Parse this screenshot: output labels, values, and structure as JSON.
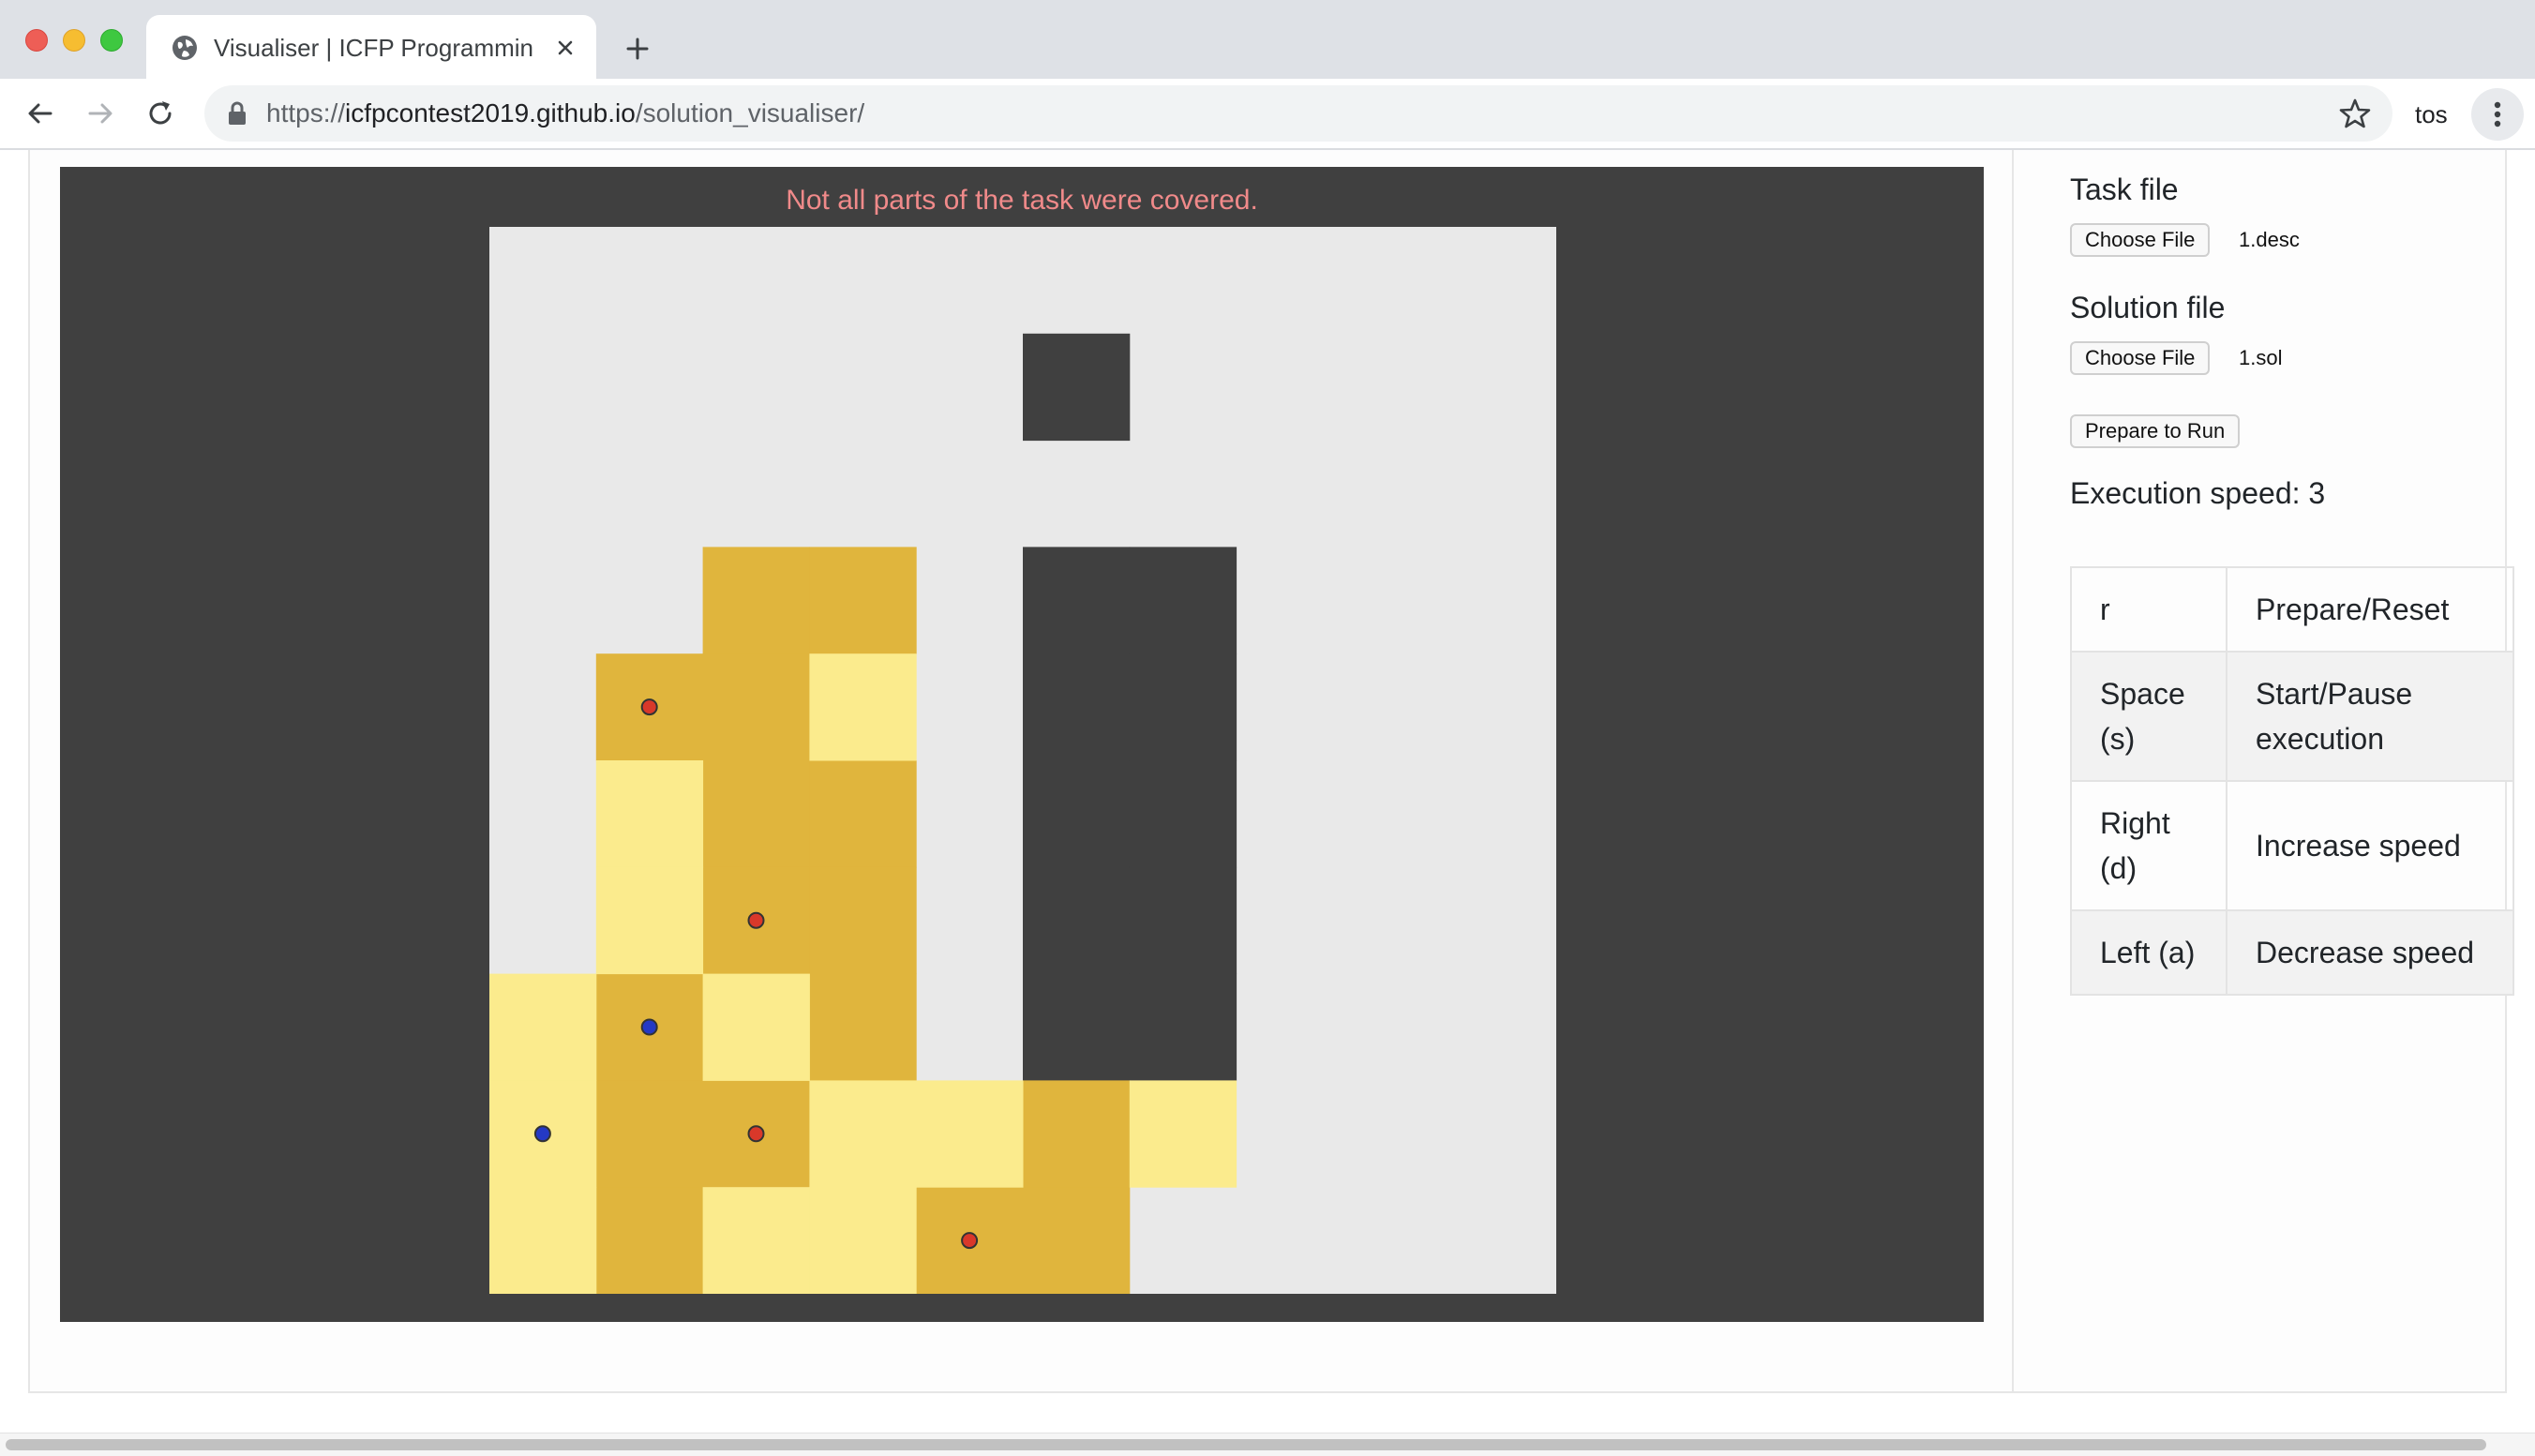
{
  "browser": {
    "tab_title": "Visualiser | ICFP Programming",
    "url_scheme": "https://",
    "url_host": "icfpcontest2019.github.io",
    "url_path": "/solution_visualiser/",
    "profile_name": "tos"
  },
  "canvas": {
    "status_message": "Not all parts of the task were covered.",
    "grid": {
      "cells": 10,
      "colors": {
        "free": "#e9e9e9",
        "obstacle": "#404040",
        "wrapped": "#e0b53d",
        "covered": "#fbeb8d",
        "booster_red": "#d9382a",
        "booster_blue": "#2439c5"
      },
      "obstacles": [
        [
          5,
          1
        ],
        [
          5,
          3
        ],
        [
          5,
          4
        ],
        [
          5,
          5
        ],
        [
          5,
          6
        ],
        [
          5,
          7
        ],
        [
          6,
          3
        ],
        [
          6,
          4
        ],
        [
          6,
          5
        ],
        [
          6,
          6
        ],
        [
          6,
          7
        ]
      ],
      "wrapped": [
        [
          2,
          3
        ],
        [
          3,
          3
        ],
        [
          1,
          4
        ],
        [
          2,
          4
        ],
        [
          2,
          5
        ],
        [
          3,
          5
        ],
        [
          2,
          6
        ],
        [
          3,
          6
        ],
        [
          1,
          7
        ],
        [
          3,
          7
        ],
        [
          1,
          8
        ],
        [
          2,
          8
        ],
        [
          5,
          8
        ],
        [
          1,
          9
        ],
        [
          4,
          9
        ],
        [
          5,
          9
        ]
      ],
      "covered": [
        [
          3,
          4
        ],
        [
          1,
          5
        ],
        [
          1,
          6
        ],
        [
          0,
          7
        ],
        [
          2,
          7
        ],
        [
          0,
          8
        ],
        [
          3,
          8
        ],
        [
          4,
          8
        ],
        [
          6,
          8
        ],
        [
          0,
          9
        ],
        [
          2,
          9
        ],
        [
          3,
          9
        ]
      ],
      "boosters_red": [
        [
          1,
          4
        ],
        [
          2,
          6
        ],
        [
          2,
          8
        ],
        [
          4,
          9
        ]
      ],
      "boosters_blue": [
        [
          1,
          7
        ],
        [
          0,
          8
        ]
      ]
    }
  },
  "panel": {
    "task_file_label": "Task file",
    "task_file_button": "Choose File",
    "task_file_name": "1.desc",
    "solution_file_label": "Solution file",
    "solution_file_button": "Choose File",
    "solution_file_name": "1.sol",
    "prepare_button": "Prepare to Run",
    "execution_speed": "Execution speed: 3",
    "keys": [
      {
        "key": "r",
        "action": "Prepare/Reset"
      },
      {
        "key": "Space (s)",
        "action": "Start/Pause execution"
      },
      {
        "key": "Right (d)",
        "action": "Increase speed"
      },
      {
        "key": "Left (a)",
        "action": "Decrease speed"
      }
    ]
  }
}
